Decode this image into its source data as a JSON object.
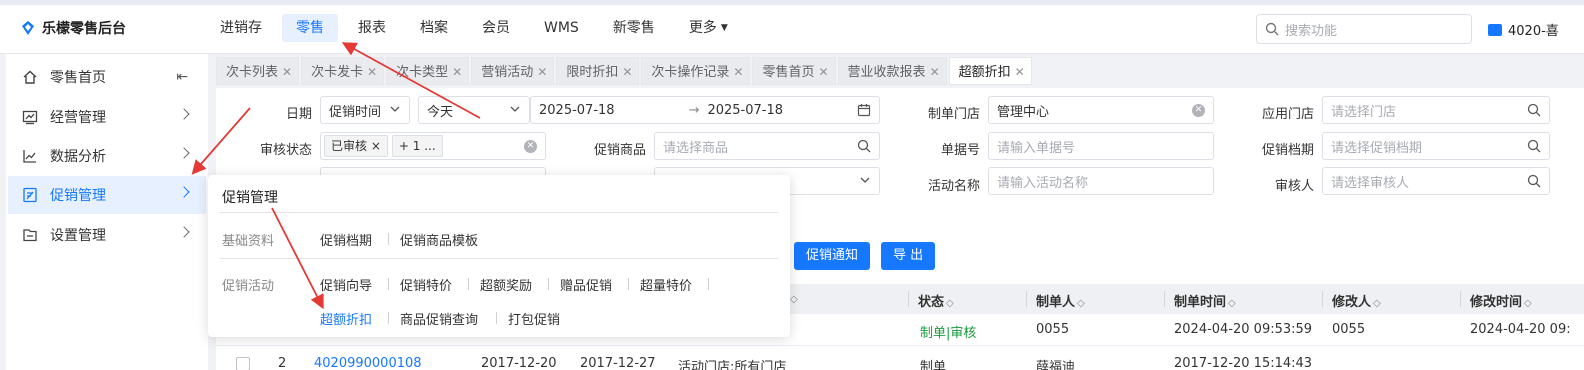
{
  "app": {
    "logo_text": "乐檬零售后台"
  },
  "nav": {
    "items": [
      "进销存",
      "零售",
      "报表",
      "档案",
      "会员",
      "WMS",
      "新零售",
      "更多"
    ],
    "active_index": 1,
    "search_placeholder": "搜索功能",
    "user_label": "4020-喜"
  },
  "sidebar": {
    "items": [
      "零售首页",
      "经营管理",
      "数据分析",
      "促销管理",
      "设置管理"
    ],
    "icons": [
      "home-icon",
      "chart-box-icon",
      "line-chart-icon",
      "promo-icon",
      "settings-box-icon"
    ],
    "active_index": 3,
    "collapse_icon": "⇤"
  },
  "tabs": {
    "items": [
      "次卡列表",
      "次卡发卡",
      "次卡类型",
      "营销活动",
      "限时折扣",
      "次卡操作记录",
      "零售首页",
      "营业收款报表",
      "超额折扣"
    ],
    "active_index": 8
  },
  "filters": {
    "date_label": "日期",
    "date_type": "促销时间",
    "date_range": "今天",
    "date_start": "2025-07-18",
    "date_sep": "→",
    "date_end": "2025-07-18",
    "store_label": "制单门店",
    "store_value": "管理中心",
    "apply_store_label": "应用门店",
    "apply_store_placeholder": "请选择门店",
    "audit_label": "审核状态",
    "audit_chip1": "已审核",
    "audit_chip2": "+ 1 ...",
    "goods_label": "促销商品",
    "goods_placeholder": "请选择商品",
    "bill_label": "单据号",
    "bill_placeholder": "请输入单据号",
    "archive_label": "促销档期",
    "archive_placeholder": "请选择促销档期",
    "activity_label": "活动名称",
    "activity_placeholder": "请输入活动名称",
    "auditor_label": "审核人",
    "auditor_placeholder": "请选择审核人"
  },
  "buttons": {
    "notify": "促销通知",
    "export": "导 出"
  },
  "table": {
    "headers": [
      "状态",
      "制单人",
      "制单时间",
      "修改人",
      "修改时间"
    ],
    "rows": [
      {
        "status": "制单|审核",
        "creator": "0055",
        "created": "2024-04-20 09:53:59",
        "modifier": "0055",
        "modified": "2024-04-20 09:"
      },
      {
        "index": "2",
        "bill": "4020990000108",
        "start": "2017-12-20",
        "end": "2017-12-27",
        "scope": "活动门店:所有门店",
        "status": "制单",
        "creator": "薛福迪",
        "created": "2017-12-20 15:14:43"
      }
    ]
  },
  "flyout": {
    "title": "促销管理",
    "cat1": "基础资料",
    "cat1_links": [
      "促销档期",
      "促销商品模板"
    ],
    "cat2": "促销活动",
    "cat2_row1": [
      "促销向导",
      "促销特价",
      "超额奖励",
      "赠品促销",
      "超量特价"
    ],
    "cat2_row2": [
      "超额折扣",
      "商品促销查询",
      "打包促销"
    ]
  },
  "colors": {
    "accent": "#1677ff",
    "annotation": "#e53935"
  }
}
